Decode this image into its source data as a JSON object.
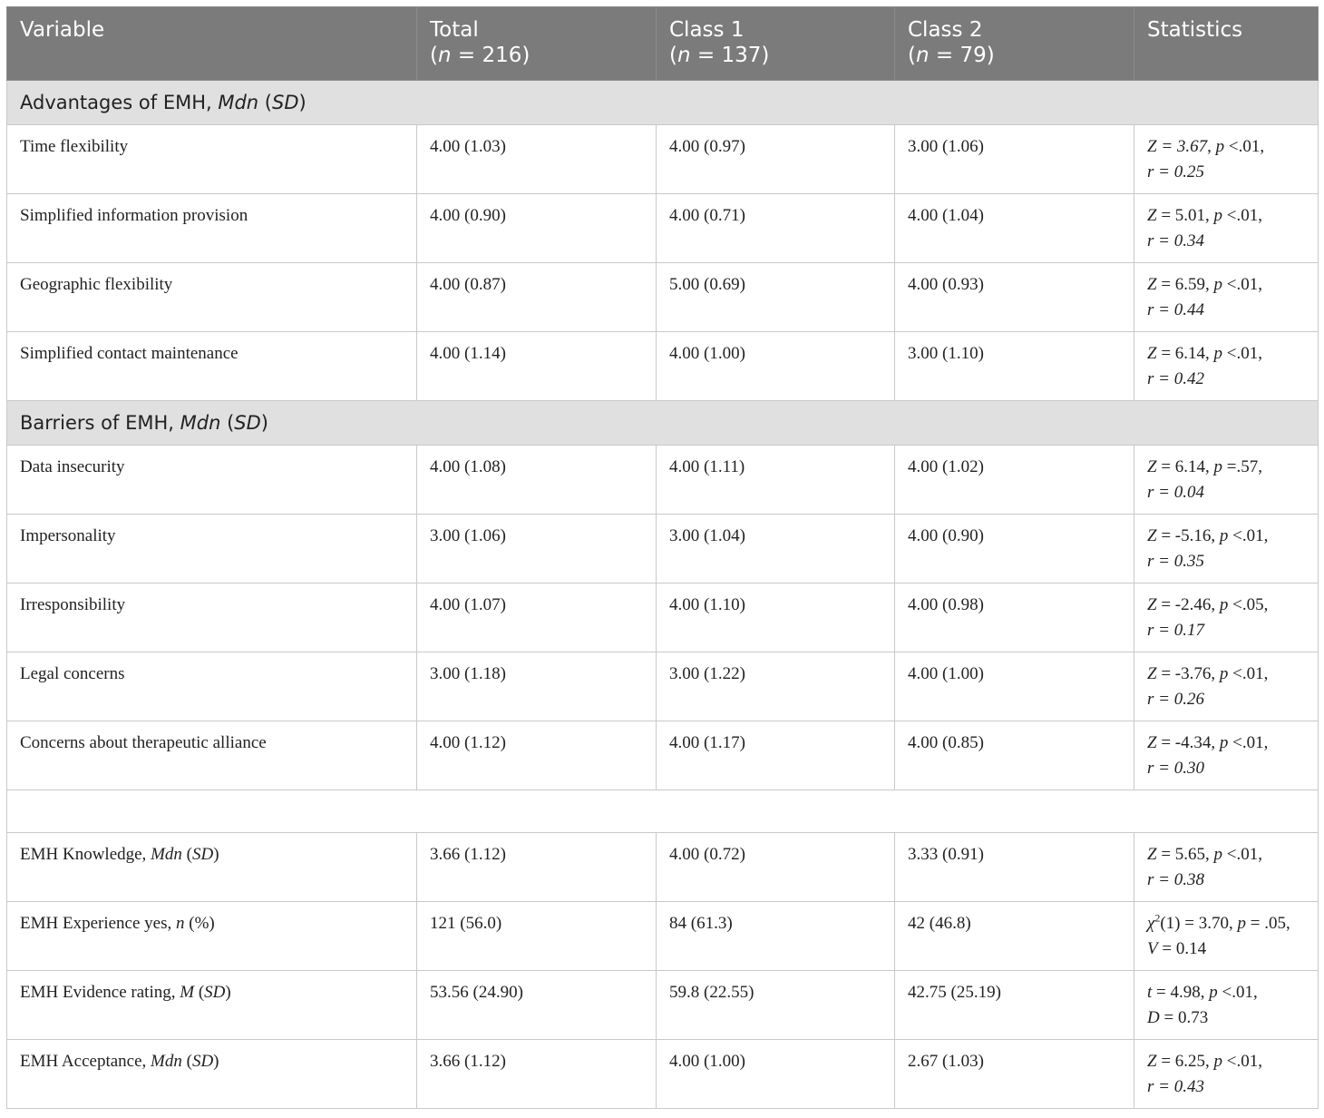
{
  "header": {
    "variable": "Variable",
    "total": {
      "label": "Total",
      "n_open": "(",
      "n_italic": "n",
      "n_rest": " = 216)"
    },
    "class1": {
      "label": "Class 1",
      "n_open": "(",
      "n_italic": "n",
      "n_rest": " = 137)"
    },
    "class2": {
      "label": "Class 2",
      "n_open": "(",
      "n_italic": "n",
      "n_rest": " = 79)"
    },
    "statistics": "Statistics"
  },
  "sections": {
    "advantages": {
      "prefix": "Advantages of EMH, ",
      "italic1": "Mdn",
      "mid": " (",
      "italic2": "SD",
      "suffix": ")"
    },
    "barriers": {
      "prefix": "Barriers of EMH, ",
      "italic1": "Mdn",
      "mid": " (",
      "italic2": "SD",
      "suffix": ")"
    }
  },
  "advantages_rows": [
    {
      "variable": "Time flexibility",
      "total": "4.00 (1.03)",
      "class1": "4.00 (0.97)",
      "class2": "3.00 (1.06)",
      "stat1_a": "Z = 3.67",
      "stat1_b": ", ",
      "stat1_c": "p",
      "stat1_d": " <.01,",
      "stat2": "r = 0.25"
    },
    {
      "variable": "Simplified information provision",
      "total": "4.00 (0.90)",
      "class1": "4.00 (0.71)",
      "class2": "4.00 (1.04)",
      "stat1_a": "Z",
      "stat1_b": " = 5.01, ",
      "stat1_c": "p",
      "stat1_d": " <.01,",
      "stat2": "r = 0.34"
    },
    {
      "variable": "Geographic flexibility",
      "total": "4.00 (0.87)",
      "class1": "5.00 (0.69)",
      "class2": "4.00 (0.93)",
      "stat1_a": "Z",
      "stat1_b": " = 6.59, ",
      "stat1_c": "p",
      "stat1_d": " <.01,",
      "stat2": "r = 0.44"
    },
    {
      "variable": "Simplified contact maintenance",
      "total": "4.00 (1.14)",
      "class1": "4.00 (1.00)",
      "class2": "3.00 (1.10)",
      "stat1_a": "Z",
      "stat1_b": " = 6.14, ",
      "stat1_c": "p",
      "stat1_d": " <.01,",
      "stat2": "r = 0.42"
    }
  ],
  "barriers_rows": [
    {
      "variable": "Data insecurity",
      "total": "4.00 (1.08)",
      "class1": "4.00 (1.11)",
      "class2": "4.00 (1.02)",
      "stat1_a": "Z",
      "stat1_b": " = 6.14, ",
      "stat1_c": "p",
      "stat1_d": " =.57,",
      "stat2": "r = 0.04"
    },
    {
      "variable": "Impersonality",
      "total": "3.00 (1.06)",
      "class1": "3.00 (1.04)",
      "class2": "4.00 (0.90)",
      "stat1_a": "Z",
      "stat1_b": " = -5.16, ",
      "stat1_c": "p",
      "stat1_d": " <.01,",
      "stat2": "r = 0.35"
    },
    {
      "variable": "Irresponsibility",
      "total": "4.00 (1.07)",
      "class1": "4.00 (1.10)",
      "class2": "4.00 (0.98)",
      "stat1_a": "Z",
      "stat1_b": " = -2.46, ",
      "stat1_c": "p",
      "stat1_d": " <.05,",
      "stat2": "r = 0.17"
    },
    {
      "variable": "Legal concerns",
      "total": "3.00 (1.18)",
      "class1": "3.00 (1.22)",
      "class2": "4.00 (1.00)",
      "stat1_a": "Z",
      "stat1_b": " = -3.76, ",
      "stat1_c": "p",
      "stat1_d": " <.01,",
      "stat2": "r = 0.26"
    },
    {
      "variable": "Concerns about therapeutic alliance",
      "total": "4.00 (1.12)",
      "class1": "4.00 (1.17)",
      "class2": "4.00 (0.85)",
      "stat1_a": "Z",
      "stat1_b": " = -4.34, ",
      "stat1_c": "p",
      "stat1_d": " <.01,",
      "stat2": "r = 0.30"
    }
  ],
  "other_rows": {
    "knowledge": {
      "label_a": "EMH Knowledge, ",
      "label_i1": "Mdn",
      "label_b": " (",
      "label_i2": "SD",
      "label_c": ")",
      "total": "3.66 (1.12)",
      "class1": "4.00 (0.72)",
      "class2": "3.33 (0.91)",
      "stat1_a": "Z",
      "stat1_b": " = 5.65, ",
      "stat1_c": "p",
      "stat1_d": " <.01,",
      "stat2": "r = 0.38"
    },
    "experience": {
      "label_a": "EMH Experience yes, ",
      "label_i1": "n",
      "label_b": " (%)",
      "total": "121 (56.0)",
      "class1": "84 (61.3)",
      "class2": "42 (46.8)",
      "stat1_chi": "χ",
      "stat1_sup": "2",
      "stat1_b": "(1) = 3.70, ",
      "stat1_c": "p",
      "stat1_d": " = .05,",
      "stat2_i": "V",
      "stat2_r": " = 0.14"
    },
    "evidence": {
      "label_a": "EMH Evidence rating, ",
      "label_i1": "M",
      "label_b": " (",
      "label_i2": "SD",
      "label_c": ")",
      "total": "53.56 (24.90)",
      "class1": "59.8 (22.55)",
      "class2": "42.75 (25.19)",
      "stat1_a": "t",
      "stat1_b": " = 4.98, ",
      "stat1_c": "p",
      "stat1_d": " <.01,",
      "stat2_i": "D",
      "stat2_r": " = 0.73"
    },
    "acceptance": {
      "label_a": "EMH Acceptance, ",
      "label_i1": "Mdn",
      "label_b": " (",
      "label_i2": "SD",
      "label_c": ")",
      "total": "3.66 (1.12)",
      "class1": "4.00 (1.00)",
      "class2": "2.67 (1.03)",
      "stat1_a": "Z",
      "stat1_b": " = 6.25, ",
      "stat1_c": "p",
      "stat1_d": " <.01,",
      "stat2": "r = 0.43"
    }
  }
}
